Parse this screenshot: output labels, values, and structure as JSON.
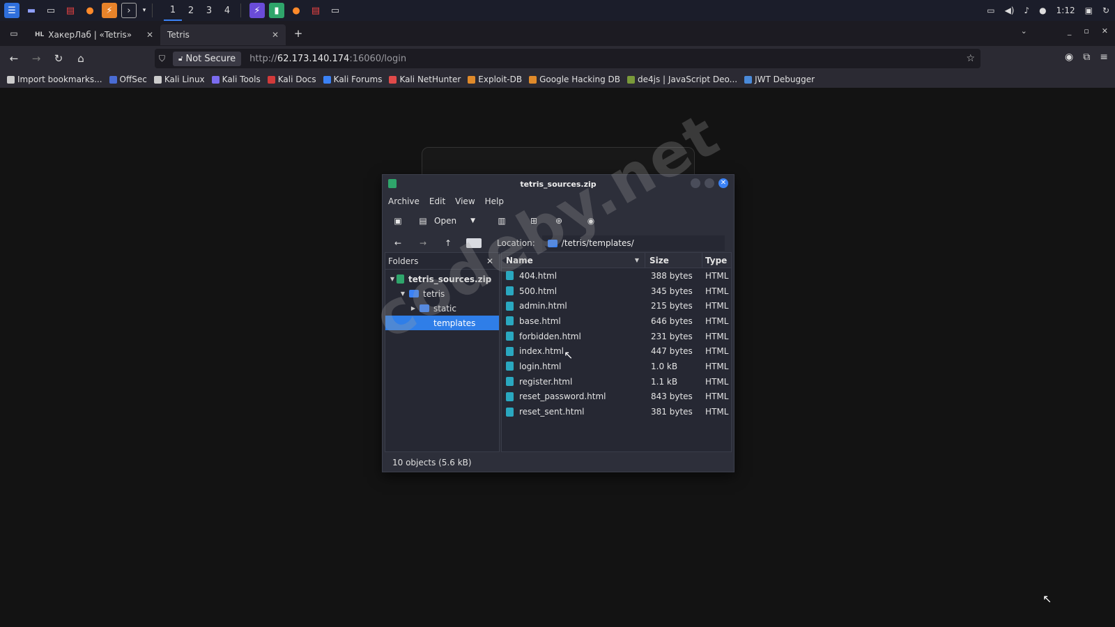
{
  "panel": {
    "workspaces": [
      "1",
      "2",
      "3",
      "4"
    ],
    "clock": "1:12"
  },
  "browser": {
    "tabs": [
      {
        "favicon": "HL",
        "label": "ХакерЛаб | «Tetris»"
      },
      {
        "favicon": "",
        "label": "Tetris"
      }
    ],
    "new_tab": "+",
    "security_label": "Not Secure",
    "url_prefix": "http://",
    "url_host": "62.173.140.174",
    "url_rest": ":16060/login",
    "bookmarks": [
      {
        "label": "Import bookmarks...",
        "icon": "import-icon",
        "color": "#cccccc"
      },
      {
        "label": "OffSec",
        "icon": "offsec-icon",
        "color": "#4a6cd4"
      },
      {
        "label": "Kali Linux",
        "icon": "kali-icon",
        "color": "#cccccc"
      },
      {
        "label": "Kali Tools",
        "icon": "kali-tools-icon",
        "color": "#7b6cf0"
      },
      {
        "label": "Kali Docs",
        "icon": "kali-docs-icon",
        "color": "#d23a3a"
      },
      {
        "label": "Kali Forums",
        "icon": "kali-forums-icon",
        "color": "#3b82f6"
      },
      {
        "label": "Kali NetHunter",
        "icon": "nethunter-icon",
        "color": "#e04a4a"
      },
      {
        "label": "Exploit-DB",
        "icon": "exploitdb-icon",
        "color": "#e08a2a"
      },
      {
        "label": "Google Hacking DB",
        "icon": "ghdb-icon",
        "color": "#e08a2a"
      },
      {
        "label": "de4js | JavaScript Deo...",
        "icon": "de4js-icon",
        "color": "#7a9a3a"
      },
      {
        "label": "JWT Debugger",
        "icon": "jwt-icon",
        "color": "#4a8ad8"
      }
    ]
  },
  "archive": {
    "title": "tetris_sources.zip",
    "menu": [
      "Archive",
      "Edit",
      "View",
      "Help"
    ],
    "toolbar": {
      "open_label": "Open"
    },
    "location_label": "Location:",
    "location_value": "/tetris/templates/",
    "folders_header": "Folders",
    "tree": [
      {
        "label": "tetris_sources.zip",
        "indent": 0,
        "expander": "▼",
        "kind": "zip"
      },
      {
        "label": "tetris",
        "indent": 1,
        "expander": "▼",
        "kind": "folder"
      },
      {
        "label": "static",
        "indent": 2,
        "expander": "▶",
        "kind": "folder"
      },
      {
        "label": "templates",
        "indent": 2,
        "expander": "",
        "kind": "folder-selected"
      }
    ],
    "columns": {
      "name": "Name",
      "size": "Size",
      "type": "Type"
    },
    "files": [
      {
        "name": "404.html",
        "size": "388 bytes",
        "type": "HTML"
      },
      {
        "name": "500.html",
        "size": "345 bytes",
        "type": "HTML"
      },
      {
        "name": "admin.html",
        "size": "215 bytes",
        "type": "HTML"
      },
      {
        "name": "base.html",
        "size": "646 bytes",
        "type": "HTML"
      },
      {
        "name": "forbidden.html",
        "size": "231 bytes",
        "type": "HTML"
      },
      {
        "name": "index.html",
        "size": "447 bytes",
        "type": "HTML"
      },
      {
        "name": "login.html",
        "size": "1.0 kB",
        "type": "HTML"
      },
      {
        "name": "register.html",
        "size": "1.1 kB",
        "type": "HTML"
      },
      {
        "name": "reset_password.html",
        "size": "843 bytes",
        "type": "HTML"
      },
      {
        "name": "reset_sent.html",
        "size": "381 bytes",
        "type": "HTML"
      }
    ],
    "status": "10 objects (5.6 kB)"
  },
  "watermark": "codeby.net"
}
